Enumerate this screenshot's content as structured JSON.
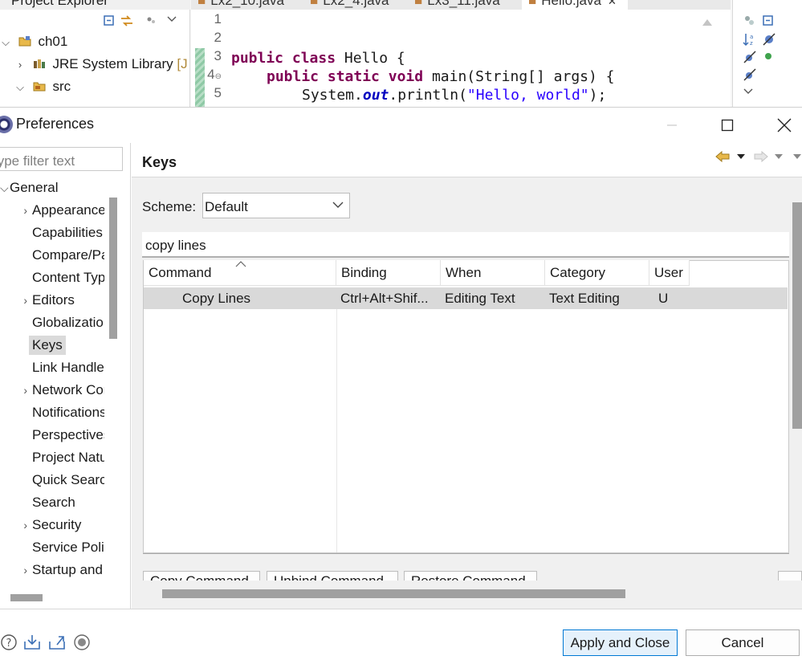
{
  "background": {
    "project_explorer": {
      "tab_label": "Project Explorer",
      "tree": [
        {
          "label": "ch01",
          "twist": "⌵"
        },
        {
          "label": "JRE System Library",
          "suffix": "[J",
          "twist": "›"
        },
        {
          "label": "src",
          "twist": "⌵"
        }
      ]
    },
    "editor_tabs": [
      "Lx2_10.java",
      "Lx2_4.java",
      "Lx3_11.java",
      "Hello.java"
    ],
    "active_tab": "Hello.java",
    "code": {
      "line_numbers": [
        "1",
        "2",
        "3",
        "4",
        "5"
      ],
      "line3": {
        "kw1": "public",
        "kw2": "class",
        "rest": " Hello {"
      },
      "line4": {
        "kw1": "public",
        "kw2": "static",
        "kw3": "void",
        "rest": " main(String[] args) {"
      },
      "line5": {
        "pre": "System.",
        "field": "out",
        "mid": ".println(",
        "str": "\"Hello, world\"",
        "end": ");"
      }
    }
  },
  "dialog": {
    "title": "Preferences",
    "filter_placeholder": "type filter text",
    "nav": [
      {
        "label": "General",
        "twist": "⌵",
        "level": 0
      },
      {
        "label": "Appearance",
        "twist": "›",
        "level": 1
      },
      {
        "label": "Capabilities",
        "twist": "",
        "level": 1
      },
      {
        "label": "Compare/Patch",
        "twist": "",
        "level": 1
      },
      {
        "label": "Content Types",
        "twist": "",
        "level": 1
      },
      {
        "label": "Editors",
        "twist": "›",
        "level": 1
      },
      {
        "label": "Globalization",
        "twist": "",
        "level": 1
      },
      {
        "label": "Keys",
        "twist": "",
        "level": 1,
        "selected": true
      },
      {
        "label": "Link Handlers",
        "twist": "",
        "level": 1
      },
      {
        "label": "Network Connections",
        "twist": "›",
        "level": 1
      },
      {
        "label": "Notifications",
        "twist": "",
        "level": 1
      },
      {
        "label": "Perspectives",
        "twist": "",
        "level": 1
      },
      {
        "label": "Project Natures",
        "twist": "",
        "level": 1
      },
      {
        "label": "Quick Search",
        "twist": "",
        "level": 1
      },
      {
        "label": "Search",
        "twist": "",
        "level": 1
      },
      {
        "label": "Security",
        "twist": "›",
        "level": 1
      },
      {
        "label": "Service Policies",
        "twist": "",
        "level": 1
      },
      {
        "label": "Startup and Shutdown",
        "twist": "›",
        "level": 1
      }
    ],
    "page": {
      "title": "Keys",
      "scheme_label": "Scheme:",
      "scheme_value": "Default",
      "search_value": "copy lines",
      "columns": [
        "Command",
        "Binding",
        "When",
        "Category",
        "User"
      ],
      "rows": [
        {
          "command": "Copy Lines",
          "binding": "Ctrl+Alt+Shif...",
          "when": "Editing Text",
          "category": "Text Editing",
          "user": "U"
        }
      ],
      "buttons": [
        "Copy Command",
        "Unbind Command",
        "Restore Command"
      ]
    },
    "footer": {
      "apply_close": "Apply and Close",
      "cancel": "Cancel"
    }
  },
  "colors": {
    "keyword": "#7f0055",
    "string": "#2a00ff",
    "static_field": "#0000c0",
    "selection": "#d9d9d9",
    "default_button_border": "#0078d4"
  }
}
